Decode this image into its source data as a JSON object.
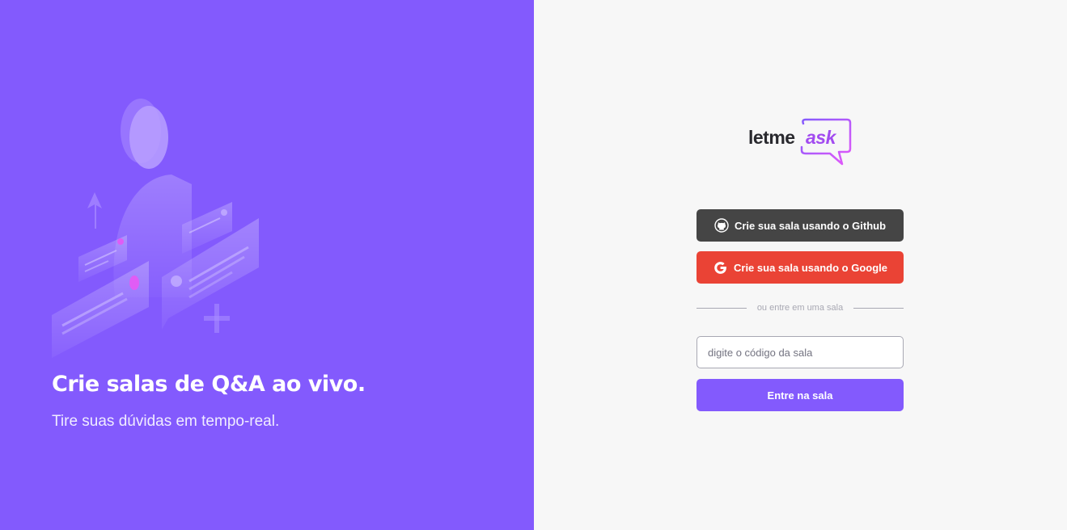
{
  "aside": {
    "title": "Crie salas de Q&A ao vivo.",
    "subtitle": "Tire suas dúvidas em tempo-real."
  },
  "logo": {
    "part1": "letme",
    "part2": "ask"
  },
  "buttons": {
    "github_label": "Crie sua sala usando o Github",
    "google_label": "Crie sua sala usando o Google",
    "enter_label": "Entre na sala"
  },
  "separator": {
    "text": "ou entre em uma sala"
  },
  "room_code": {
    "placeholder": "digite o código da sala",
    "value": ""
  },
  "icons": {
    "github": "github-icon",
    "google": "google-icon"
  },
  "colors": {
    "primary": "#835afd",
    "github": "#454545",
    "google": "#ea4335",
    "background": "#f7f7f7"
  }
}
